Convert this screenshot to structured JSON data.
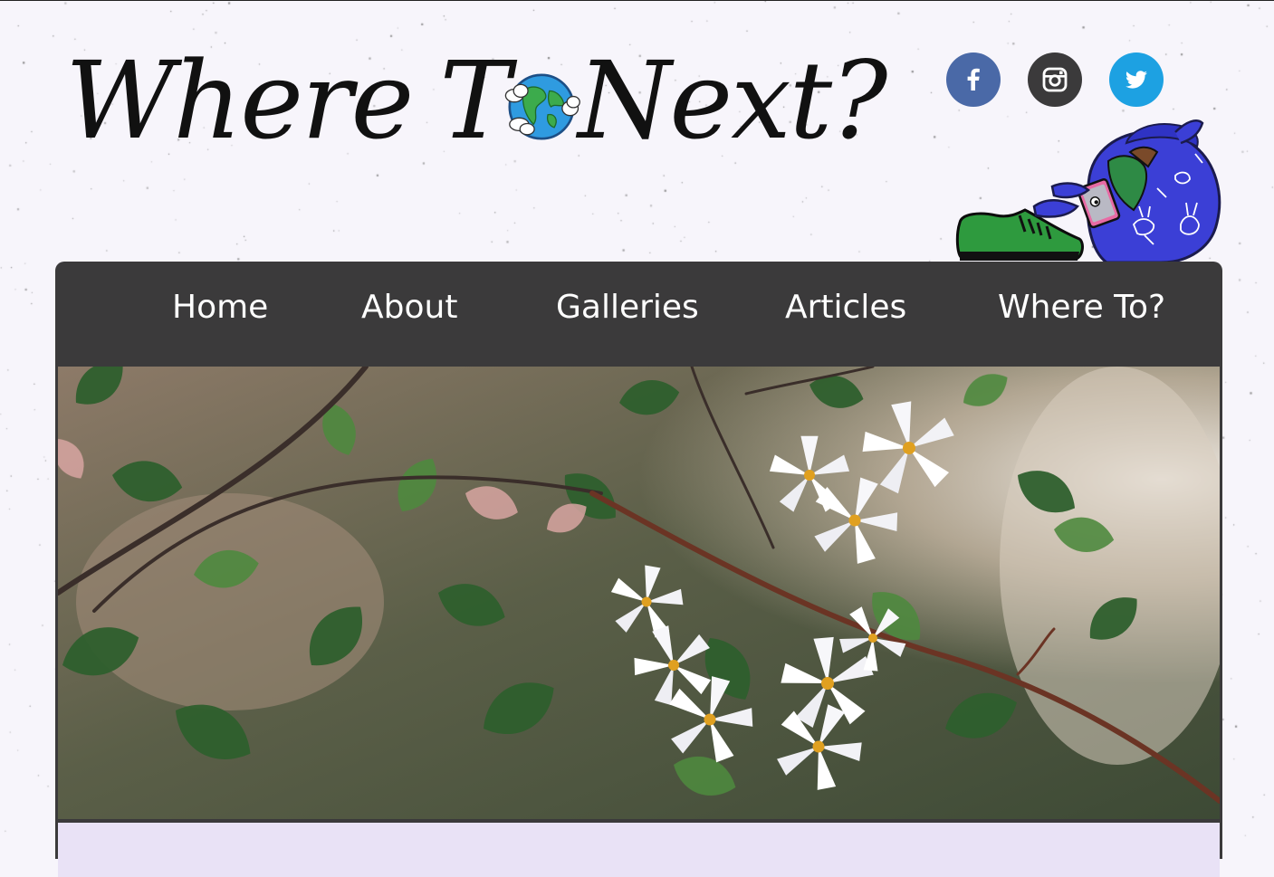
{
  "site": {
    "logo_text_1": "Where",
    "logo_text_2a": "T",
    "logo_text_2b": "Next?",
    "logo_globe_icon": "globe-icon"
  },
  "social": [
    {
      "name": "facebook",
      "icon": "facebook-icon",
      "color": "#4a69a7",
      "glyph": "f"
    },
    {
      "name": "instagram",
      "icon": "instagram-icon",
      "color": "#3b3a3b"
    },
    {
      "name": "twitter",
      "icon": "twitter-icon",
      "color": "#1da1e2"
    }
  ],
  "nav": {
    "items": [
      "Home",
      "About",
      "Galleries",
      "Articles",
      "Where To?"
    ]
  },
  "colors": {
    "background": "#f7f5fb",
    "nav_bg": "#3b3a3b",
    "nav_text": "#ffffff",
    "content_bg": "#e9e2f6"
  },
  "hero": {
    "icon": "flowers-photo"
  }
}
